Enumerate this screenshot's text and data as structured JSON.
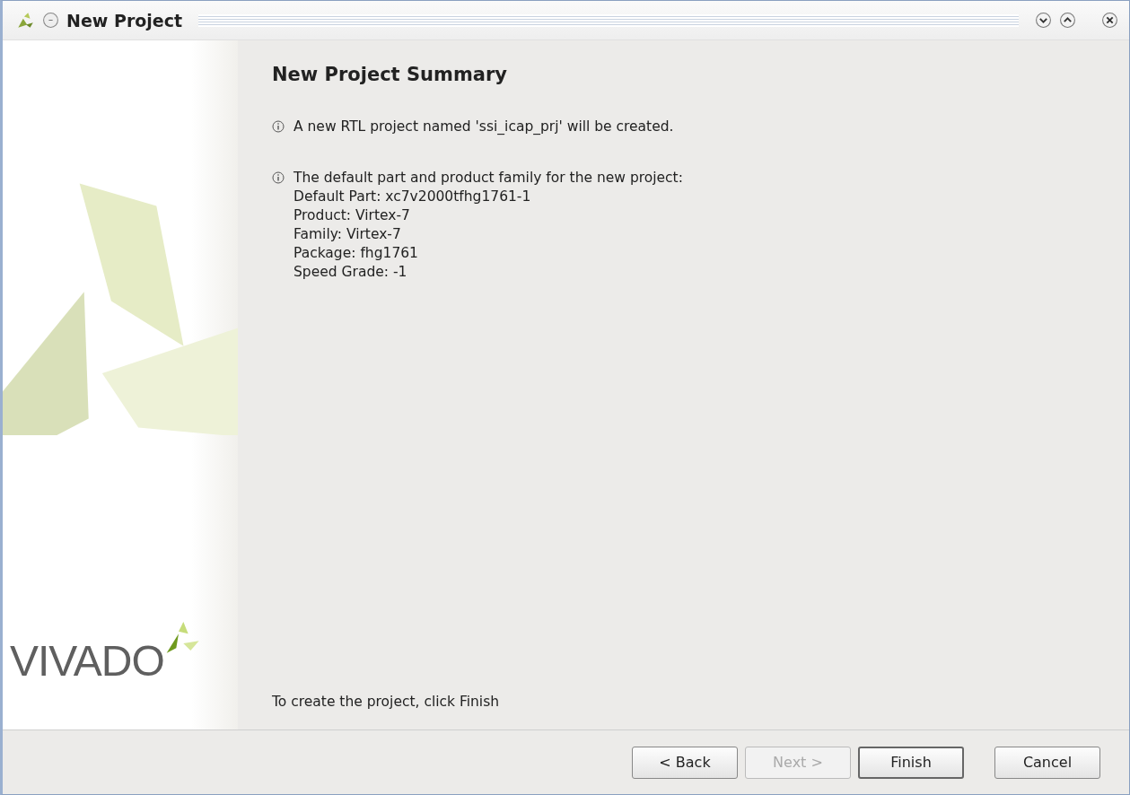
{
  "window": {
    "title": "New Project"
  },
  "page": {
    "heading": "New Project Summary",
    "messages": [
      {
        "lines": [
          "A new RTL project named 'ssi_icap_prj' will be created."
        ]
      },
      {
        "lines": [
          "The default part and product family for the new project:",
          "Default Part: xc7v2000tfhg1761-1",
          "Product: Virtex-7",
          "Family: Virtex-7",
          "Package: fhg1761",
          "Speed Grade: -1"
        ]
      }
    ],
    "footer_note": "To create the project, click Finish"
  },
  "sidebar": {
    "logo": "VIVADO"
  },
  "buttons": [
    {
      "label": "< Back",
      "disabled": false,
      "default": false
    },
    {
      "label": "Next >",
      "disabled": true,
      "default": false
    },
    {
      "label": "Finish",
      "disabled": false,
      "default": true
    },
    {
      "label": "Cancel",
      "disabled": false,
      "default": false
    }
  ]
}
